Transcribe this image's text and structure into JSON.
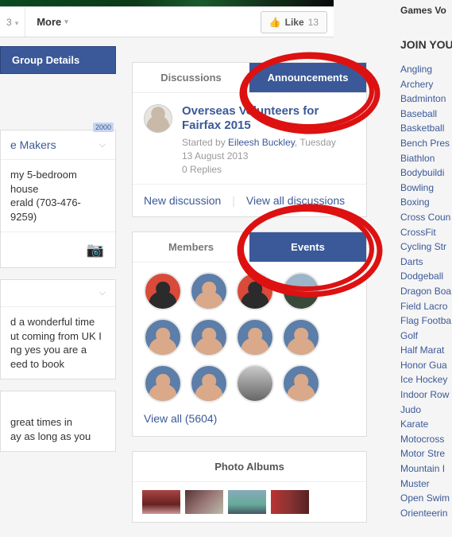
{
  "toolbar": {
    "count_suffix": "3",
    "more_label": "More",
    "like_label": "Like",
    "like_count": "13"
  },
  "sidebar": {
    "details_btn": "Group Details",
    "badge": "2000",
    "box1_header": "e Makers",
    "box1_body_l1": "my 5-bedroom house",
    "box1_body_l2": "erald (703-476-9259)",
    "box2_body_l1": "d a wonderful time",
    "box2_body_l2": "ut coming from UK I",
    "box2_body_l3": "ng yes you are a",
    "box2_body_l4": "eed to book",
    "box3_body_l1": "great times in",
    "box3_body_l2": "ay as long as you"
  },
  "discussion": {
    "tab_discussions": "Discussions",
    "tab_announcements": "Announcements",
    "title": "Overseas Volunteers for Fairfax 2015",
    "started_by_prefix": "Started by ",
    "author": "Eileesh Buckley",
    "when_sep": ", ",
    "when": "Tuesday",
    "date": "13 August 2013",
    "replies": "0 Replies",
    "new_discussion": "New discussion",
    "view_all": "View all discussions"
  },
  "members": {
    "tab_members": "Members",
    "tab_events": "Events",
    "view_all": "View all (5604)"
  },
  "photos": {
    "header": "Photo Albums"
  },
  "right": {
    "cutoff_top": "Games Vo",
    "section_title": "JOIN YOU",
    "sports": [
      "Angling",
      "Archery",
      "Badminton",
      "Baseball",
      "Basketball",
      "Bench Pres",
      "Biathlon",
      "Bodybuildi",
      "Bowling",
      "Boxing",
      "Cross Coun",
      "CrossFit",
      "Cycling Str",
      "Darts",
      "Dodgeball",
      "Dragon Boa",
      "Field Lacro",
      "Flag Footba",
      "Golf",
      "Half Marat",
      "Honor Gua",
      "Ice Hockey",
      "Indoor Row",
      "Judo",
      "Karate",
      "Motocross",
      "Motor Stre",
      "Mountain I",
      "Muster",
      "Open Swim",
      "Orienteerin"
    ]
  }
}
